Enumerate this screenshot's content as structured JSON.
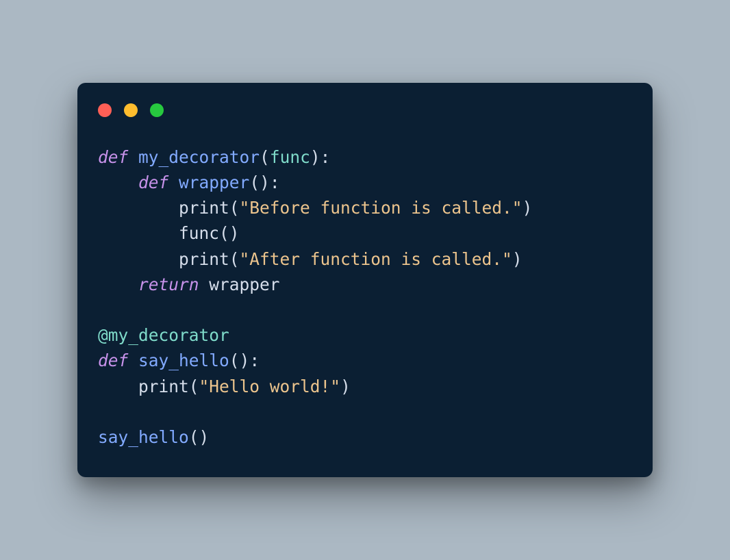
{
  "code": {
    "kw_def": "def",
    "kw_return": "return",
    "fn_my_decorator": "my_decorator",
    "fn_wrapper": "wrapper",
    "fn_say_hello": "say_hello",
    "param_func": "func",
    "call_print": "print",
    "call_func": "func",
    "str_before": "\"Before function is called.\"",
    "str_after": "\"After function is called.\"",
    "str_hello": "\"Hello world!\"",
    "decorator": "@my_decorator",
    "ret_wrapper": "wrapper",
    "call_say_hello": "say_hello",
    "lparen": "(",
    "rparen": ")",
    "colon": ":",
    "space": " "
  }
}
